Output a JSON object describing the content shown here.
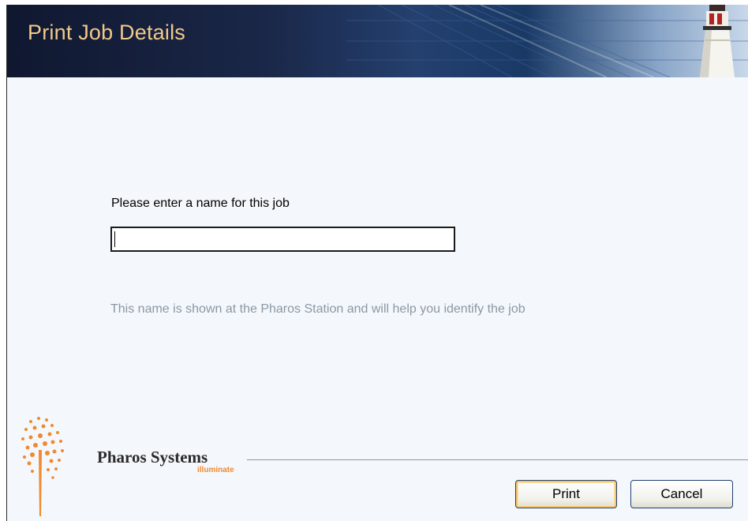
{
  "window": {
    "title": "Print Job Details"
  },
  "form": {
    "prompt_label": "Please enter a name for this job",
    "job_name_value": "",
    "job_name_placeholder": "",
    "hint": "This name is shown at the Pharos Station and will help you identify the job"
  },
  "brand": {
    "name": "Pharos Systems",
    "tagline": "illuminate"
  },
  "buttons": {
    "print_label": "Print",
    "cancel_label": "Cancel"
  },
  "colors": {
    "title": "#f2c98a",
    "hint": "#8c97a3",
    "brand_accent": "#f08a30",
    "header_dark": "#101830",
    "button_focus": "#f6c66a"
  },
  "icons": {
    "header_art": "lighthouse-icon",
    "logo": "pharos-burst-logo"
  }
}
